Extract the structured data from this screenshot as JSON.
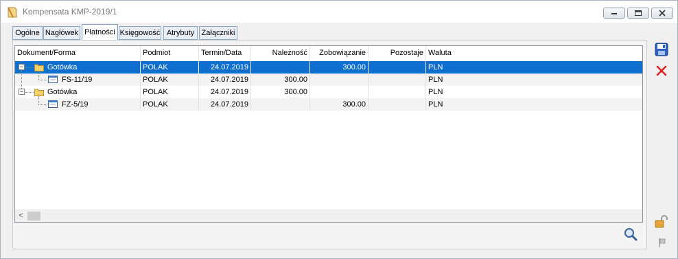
{
  "window": {
    "title": "Kompensata KMP-2019/1"
  },
  "tabs": [
    {
      "label": "Ogólne",
      "active": false
    },
    {
      "label": "Nagłówek",
      "active": false
    },
    {
      "label": "Płatności",
      "active": true
    },
    {
      "label": "Księgowość",
      "active": false
    },
    {
      "label": "Atrybuty",
      "active": false
    },
    {
      "label": "Załączniki",
      "active": false
    }
  ],
  "grid": {
    "columns": [
      "Dokument/Forma",
      "Podmiot",
      "Termin/Data",
      "Należność",
      "Zobowiązanie",
      "Pozostaje",
      "Waluta"
    ],
    "rows": [
      {
        "document": "Gotówka",
        "subject": "POLAK",
        "date": "24.07.2019",
        "receivable": "",
        "liability": "300.00",
        "remaining": "",
        "currency": "PLN"
      },
      {
        "document": "FS-11/19",
        "subject": "POLAK",
        "date": "24.07.2019",
        "receivable": "300.00",
        "liability": "",
        "remaining": "",
        "currency": "PLN"
      },
      {
        "document": "Gotówka",
        "subject": "POLAK",
        "date": "24.07.2019",
        "receivable": "300.00",
        "liability": "",
        "remaining": "",
        "currency": "PLN"
      },
      {
        "document": "FZ-5/19",
        "subject": "POLAK",
        "date": "24.07.2019",
        "receivable": "",
        "liability": "300.00",
        "remaining": "",
        "currency": "PLN"
      }
    ],
    "expander_symbol": "−",
    "scroll_left_symbol": "<"
  },
  "icons": {
    "save": "save-icon",
    "cancel": "close-icon",
    "search": "search-icon",
    "lock": "unlock-icon",
    "flag": "flag-icon"
  },
  "colors": {
    "selection": "#0f6fcf",
    "cancel_red": "#e02020",
    "save_blue": "#2a5ec0"
  }
}
